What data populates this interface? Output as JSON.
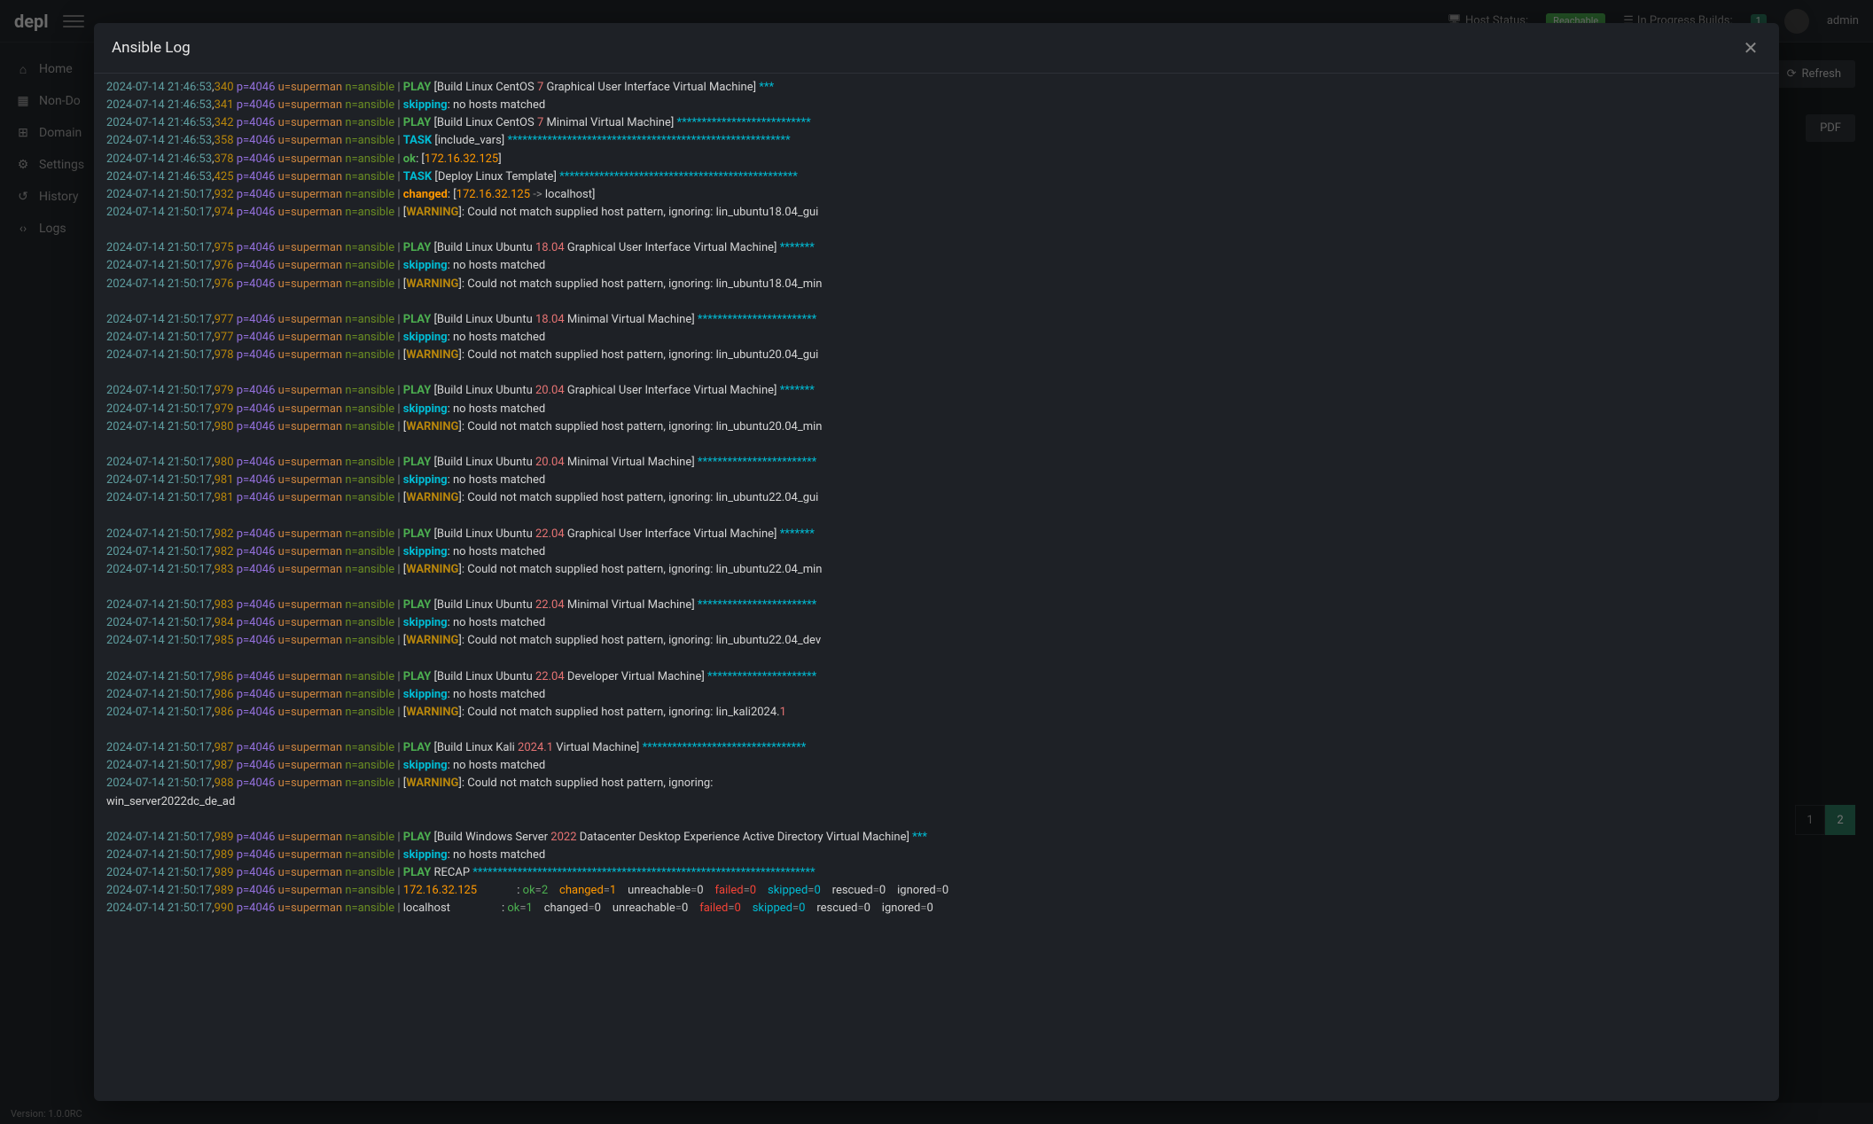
{
  "header": {
    "logo": "depl",
    "host_status_label": "Host Status:",
    "host_status_value": "Reachable",
    "in_progress_label": "In Progress Builds:",
    "in_progress_count": "1",
    "user": "admin"
  },
  "sidebar": {
    "items": [
      {
        "icon": "home",
        "label": "Home"
      },
      {
        "icon": "grid",
        "label": "Non-Do"
      },
      {
        "icon": "sitemap",
        "label": "Domain"
      },
      {
        "icon": "gear",
        "label": "Settings"
      },
      {
        "icon": "history",
        "label": "History"
      },
      {
        "icon": "code",
        "label": "Logs"
      }
    ]
  },
  "actions": {
    "refresh": "Refresh",
    "pdf": "PDF"
  },
  "pagination": {
    "pages": [
      "1",
      "2"
    ],
    "active": "2"
  },
  "footer": {
    "version": "Version: 1.0.0RC"
  },
  "modal": {
    "title": "Ansible Log"
  },
  "log": {
    "prefix_date": "2024-07-14",
    "prefix_hms1": "21:46:53",
    "prefix_hms2": "21:50:17",
    "p": "p=4046",
    "u": "u=superman",
    "n": "n=ansible",
    "lines": [
      {
        "ms": "340",
        "t": "46",
        "kind": "play",
        "text": "[Build Linux CentOS ",
        "num": "7",
        "text2": " Graphical User Interface Virtual Machine]",
        "stars": " ***"
      },
      {
        "ms": "341",
        "t": "46",
        "kind": "skip",
        "text": ": no hosts matched"
      },
      {
        "ms": "342",
        "t": "46",
        "kind": "play",
        "text": "[Build Linux CentOS ",
        "num": "7",
        "text2": " Minimal Virtual Machine]",
        "stars": " ***************************"
      },
      {
        "ms": "358",
        "t": "46",
        "kind": "task",
        "text": "[include_vars]",
        "stars": " *********************************************************"
      },
      {
        "ms": "378",
        "t": "46",
        "kind": "ok",
        "text": ": [",
        "ip": "172.16.32.125",
        "text2": "]"
      },
      {
        "ms": "425",
        "t": "46",
        "kind": "task",
        "text": "[Deploy Linux Template]",
        "stars": " ************************************************"
      },
      {
        "ms": "932",
        "t": "50",
        "kind": "changed",
        "text": ": [",
        "ip": "172.16.32.125",
        "arrow": " -> ",
        "text2": "localhost]"
      },
      {
        "ms": "974",
        "t": "50",
        "kind": "warn",
        "text": "]: Could not match supplied host pattern, ignoring: lin_ubuntu18.04_gui"
      },
      {
        "kind": "blank"
      },
      {
        "ms": "975",
        "t": "50",
        "kind": "play",
        "text": "[Build Linux Ubuntu ",
        "num": "18.04",
        "text2": " Graphical User Interface Virtual Machine]",
        "stars": " *******"
      },
      {
        "ms": "976",
        "t": "50",
        "kind": "skip",
        "text": ": no hosts matched"
      },
      {
        "ms": "976",
        "t": "50",
        "kind": "warn",
        "text": "]: Could not match supplied host pattern, ignoring: lin_ubuntu18.04_min"
      },
      {
        "kind": "blank"
      },
      {
        "ms": "977",
        "t": "50",
        "kind": "play",
        "text": "[Build Linux Ubuntu ",
        "num": "18.04",
        "text2": " Minimal Virtual Machine]",
        "stars": " ************************"
      },
      {
        "ms": "977",
        "t": "50",
        "kind": "skip",
        "text": ": no hosts matched"
      },
      {
        "ms": "978",
        "t": "50",
        "kind": "warn",
        "text": "]: Could not match supplied host pattern, ignoring: lin_ubuntu20.04_gui"
      },
      {
        "kind": "blank"
      },
      {
        "ms": "979",
        "t": "50",
        "kind": "play",
        "text": "[Build Linux Ubuntu ",
        "num": "20.04",
        "text2": " Graphical User Interface Virtual Machine]",
        "stars": " *******"
      },
      {
        "ms": "979",
        "t": "50",
        "kind": "skip",
        "text": ": no hosts matched"
      },
      {
        "ms": "980",
        "t": "50",
        "kind": "warn",
        "text": "]: Could not match supplied host pattern, ignoring: lin_ubuntu20.04_min"
      },
      {
        "kind": "blank"
      },
      {
        "ms": "980",
        "t": "50",
        "kind": "play",
        "text": "[Build Linux Ubuntu ",
        "num": "20.04",
        "text2": " Minimal Virtual Machine]",
        "stars": " ************************"
      },
      {
        "ms": "981",
        "t": "50",
        "kind": "skip",
        "text": ": no hosts matched"
      },
      {
        "ms": "981",
        "t": "50",
        "kind": "warn",
        "text": "]: Could not match supplied host pattern, ignoring: lin_ubuntu22.04_gui"
      },
      {
        "kind": "blank"
      },
      {
        "ms": "982",
        "t": "50",
        "kind": "play",
        "text": "[Build Linux Ubuntu ",
        "num": "22.04",
        "text2": " Graphical User Interface Virtual Machine]",
        "stars": " *******"
      },
      {
        "ms": "982",
        "t": "50",
        "kind": "skip",
        "text": ": no hosts matched"
      },
      {
        "ms": "983",
        "t": "50",
        "kind": "warn",
        "text": "]: Could not match supplied host pattern, ignoring: lin_ubuntu22.04_min"
      },
      {
        "kind": "blank"
      },
      {
        "ms": "983",
        "t": "50",
        "kind": "play",
        "text": "[Build Linux Ubuntu ",
        "num": "22.04",
        "text2": " Minimal Virtual Machine]",
        "stars": " ************************"
      },
      {
        "ms": "984",
        "t": "50",
        "kind": "skip",
        "text": ": no hosts matched"
      },
      {
        "ms": "985",
        "t": "50",
        "kind": "warn",
        "text": "]: Could not match supplied host pattern, ignoring: lin_ubuntu22.04_dev"
      },
      {
        "kind": "blank"
      },
      {
        "ms": "986",
        "t": "50",
        "kind": "play",
        "text": "[Build Linux Ubuntu ",
        "num": "22.04",
        "text2": " Developer Virtual Machine]",
        "stars": " **********************"
      },
      {
        "ms": "986",
        "t": "50",
        "kind": "skip",
        "text": ": no hosts matched"
      },
      {
        "ms": "986",
        "t": "50",
        "kind": "warn",
        "text": "]: Could not match supplied host pattern, ignoring: lin_kali2024.",
        "num": "1"
      },
      {
        "kind": "blank"
      },
      {
        "ms": "987",
        "t": "50",
        "kind": "play",
        "text": "[Build Linux Kali ",
        "num": "2024.1",
        "text2": " Virtual Machine]",
        "stars": " *********************************"
      },
      {
        "ms": "987",
        "t": "50",
        "kind": "skip",
        "text": ": no hosts matched"
      },
      {
        "ms": "988",
        "t": "50",
        "kind": "warn",
        "text": "]: Could not match supplied host pattern, ignoring: win_server2022dc_de_ad",
        "wrap": true
      },
      {
        "kind": "blank"
      },
      {
        "ms": "989",
        "t": "50",
        "kind": "play",
        "text": "[Build Windows Server ",
        "num": "2022",
        "text2": " Datacenter Desktop Experience Active Directory Virtual Machine]",
        "stars": " ***"
      },
      {
        "ms": "989",
        "t": "50",
        "kind": "skip",
        "text": ": no hosts matched"
      },
      {
        "ms": "989",
        "t": "50",
        "kind": "recap",
        "text": "RECAP",
        "stars": " *********************************************************************"
      },
      {
        "ms": "989",
        "t": "50",
        "kind": "recapline",
        "host": "172.16.32.125",
        "ok": "2",
        "changed": "1",
        "unreach": "0",
        "failed": "0",
        "skipped": "0",
        "rescued": "0",
        "ignored": "0",
        "hostcolor": "orange"
      },
      {
        "ms": "990",
        "t": "50",
        "kind": "recapline",
        "host": "localhost",
        "ok": "1",
        "changed": "0",
        "unreach": "0",
        "failed": "0",
        "skipped": "0",
        "rescued": "0",
        "ignored": "0",
        "hostcolor": "white"
      }
    ]
  }
}
